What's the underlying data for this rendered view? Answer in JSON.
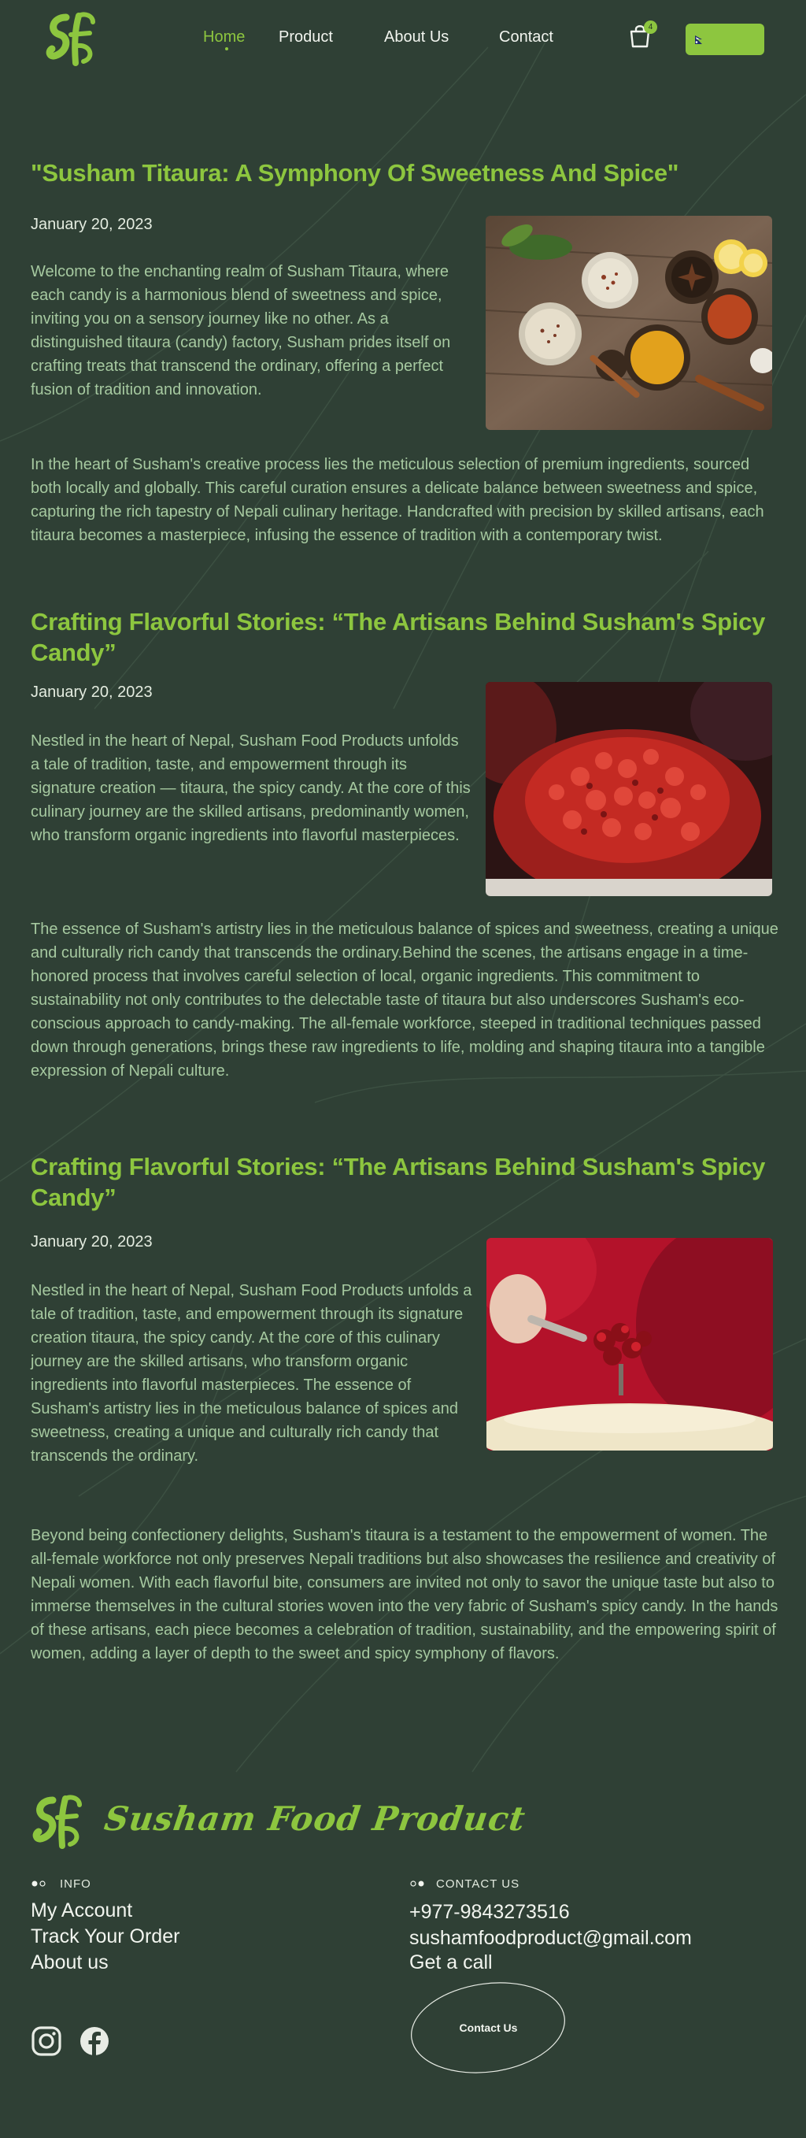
{
  "header": {
    "nav": [
      {
        "label": "Home",
        "active": true
      },
      {
        "label": "Product",
        "active": false
      },
      {
        "label": "About Us",
        "active": false
      },
      {
        "label": "Contact",
        "active": false
      }
    ],
    "cart_count": "4",
    "icons": {
      "cart": "shopping-bag-icon",
      "language": "flag-icon"
    }
  },
  "posts": [
    {
      "title": "\"Susham Titaura: A Symphony Of Sweetness And Spice\"",
      "date": "January 20, 2023",
      "intro": "Welcome to the enchanting realm of Susham Titaura, where each candy is a harmonious blend of sweetness and spice, inviting you on a sensory journey like no other. As a distinguished titaura (candy) factory, Susham prides itself on crafting treats that transcend the ordinary, offering a perfect fusion of tradition and innovation.",
      "body": "In the heart of Susham's creative process lies the meticulous selection of premium ingredients, sourced both locally and globally. This careful curation ensures a delicate balance between sweetness and spice, capturing the rich tapestry of Nepali culinary heritage. Handcrafted with precision by skilled artisans, each titaura becomes a masterpiece, infusing the essence of tradition with a contemporary twist."
    },
    {
      "title": "Crafting Flavorful Stories: “The Artisans Behind Susham's Spicy Candy”",
      "date": "January 20, 2023",
      "intro": "Nestled in the heart of Nepal, Susham Food Products unfolds a tale of tradition, taste, and empowerment through its signature creation — titaura, the spicy candy. At the core of this culinary journey are the skilled artisans, predominantly women, who transform organic ingredients into flavorful masterpieces.",
      "body": " The essence of Susham's artistry lies in the meticulous balance of spices and sweetness, creating a unique and culturally rich candy that transcends the ordinary.Behind the scenes, the artisans engage in a time-honored process that involves careful selection of local, organic ingredients. This commitment to sustainability not only contributes to the delectable taste of titaura but also underscores Susham's eco-conscious approach to candy-making. The all-female workforce, steeped in traditional techniques passed down through generations, brings these raw ingredients to life, molding and shaping titaura into a tangible expression of Nepali culture."
    },
    {
      "title": "Crafting Flavorful Stories: “The Artisans Behind Susham's Spicy Candy”",
      "date": "January 20, 2023",
      "intro": "Nestled in the heart of Nepal, Susham Food Products unfolds a tale of tradition, taste, and empowerment through its signature creation  titaura, the spicy candy. At the core of this culinary journey are the skilled artisans, who transform organic ingredients into flavorful masterpieces. The essence of Susham's artistry lies in the meticulous balance of spices and sweetness, creating a unique and culturally rich candy that transcends the ordinary.",
      "body": "Beyond being confectionery delights, Susham's titaura is a testament to the empowerment of women. The all-female workforce not only preserves Nepali traditions but also showcases the resilience and creativity of Nepali women. With each flavorful bite, consumers are invited not only to savor the unique taste but also to immerse themselves in the cultural stories woven into the very fabric of Susham's spicy candy. In the hands of these artisans, each piece becomes a celebration of tradition, sustainability, and the empowering spirit of women, adding a layer of depth to the sweet and spicy symphony of flavors."
    }
  ],
  "footer": {
    "brand": "Susham Food Product",
    "info_heading": "INFO",
    "info_links": [
      "My Account",
      "Track Your Order",
      "About us"
    ],
    "contact_heading": "CONTACT US",
    "phone": "+977-9843273516",
    "email": "sushamfoodproduct@gmail.com",
    "call": "Get a call",
    "contact_button": "Contact Us",
    "social_icons": [
      "instagram-icon",
      "facebook-icon"
    ]
  },
  "colors": {
    "background": "#2f4035",
    "accent": "#8dc63f",
    "body_text": "#a6c9a0"
  }
}
